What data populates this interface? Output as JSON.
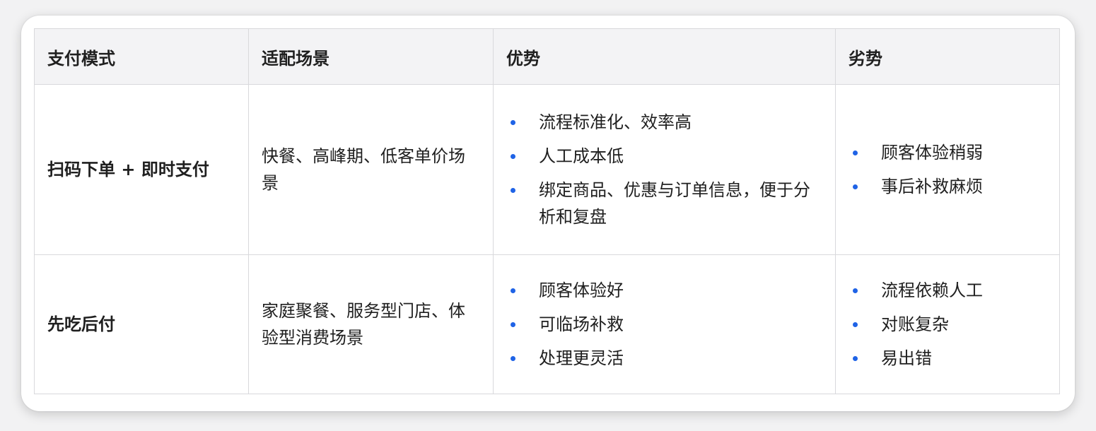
{
  "table": {
    "headers": [
      "支付模式",
      "适配场景",
      "优势",
      "劣势"
    ],
    "rows": [
      {
        "mode": "扫码下单 + 即时支付",
        "scenario": "快餐、高峰期、低客单价场景",
        "pros": [
          "流程标准化、效率高",
          "人工成本低",
          "绑定商品、优惠与订单信息，便于分析和复盘"
        ],
        "cons": [
          "顾客体验稍弱",
          "事后补救麻烦"
        ]
      },
      {
        "mode": "先吃后付",
        "scenario": "家庭聚餐、服务型门店、体验型消费场景",
        "pros": [
          "顾客体验好",
          "可临场补救",
          "处理更灵活"
        ],
        "cons": [
          "流程依赖人工",
          "对账复杂",
          "易出错"
        ]
      }
    ]
  },
  "colors": {
    "bullet": "#1f63e6",
    "header_bg": "#f3f3f5",
    "border": "#d9d9dc"
  }
}
